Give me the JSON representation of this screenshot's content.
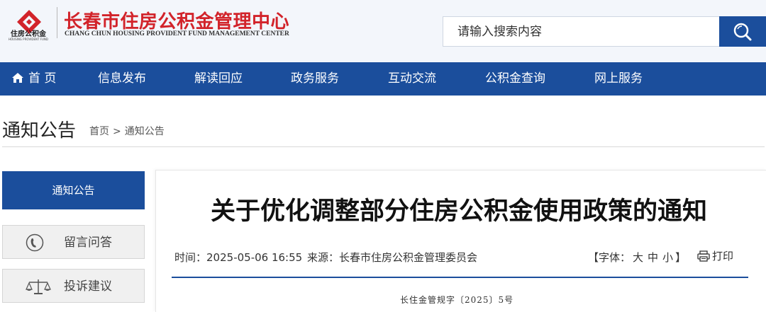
{
  "header": {
    "logo_text": "住房公积金",
    "logo_subtext": "HOUSING PROVIDENT FUND",
    "site_title": "长春市住房公积金管理中心",
    "site_subtitle": "CHANG CHUN HOUSING PROVIDENT FUND MANAGEMENT CENTER",
    "brand_color": "#d2232a"
  },
  "search": {
    "placeholder": "请输入搜索内容",
    "button_icon": "search-icon"
  },
  "nav": {
    "background": "#1b4e9c",
    "items": [
      {
        "label": "首 页",
        "icon": "home-icon"
      },
      {
        "label": "信息发布"
      },
      {
        "label": "解读回应"
      },
      {
        "label": "政务服务"
      },
      {
        "label": "互动交流"
      },
      {
        "label": "公积金查询"
      },
      {
        "label": "网上服务"
      }
    ]
  },
  "page": {
    "title": "通知公告",
    "breadcrumb": [
      "首页",
      "通知公告"
    ],
    "breadcrumb_sep": ">"
  },
  "sidebar": {
    "items": [
      {
        "label": "通知公告",
        "active": true
      },
      {
        "label": "留言问答",
        "icon": "phone-icon"
      },
      {
        "label": "投诉建议",
        "icon": "scales-icon"
      }
    ]
  },
  "article": {
    "title": "关于优化调整部分住房公积金使用政策的通知",
    "time_label": "时间：",
    "time": "2025-05-06 16:55",
    "source_label": "来源：",
    "source": "长春市住房公积金管理委员会",
    "font_size_label_open": "【字体：",
    "font_sizes": [
      "大",
      "中",
      "小"
    ],
    "font_size_label_close": "】",
    "print_label": "打印",
    "doc_number": "长住金管规字〔2025〕5号"
  }
}
